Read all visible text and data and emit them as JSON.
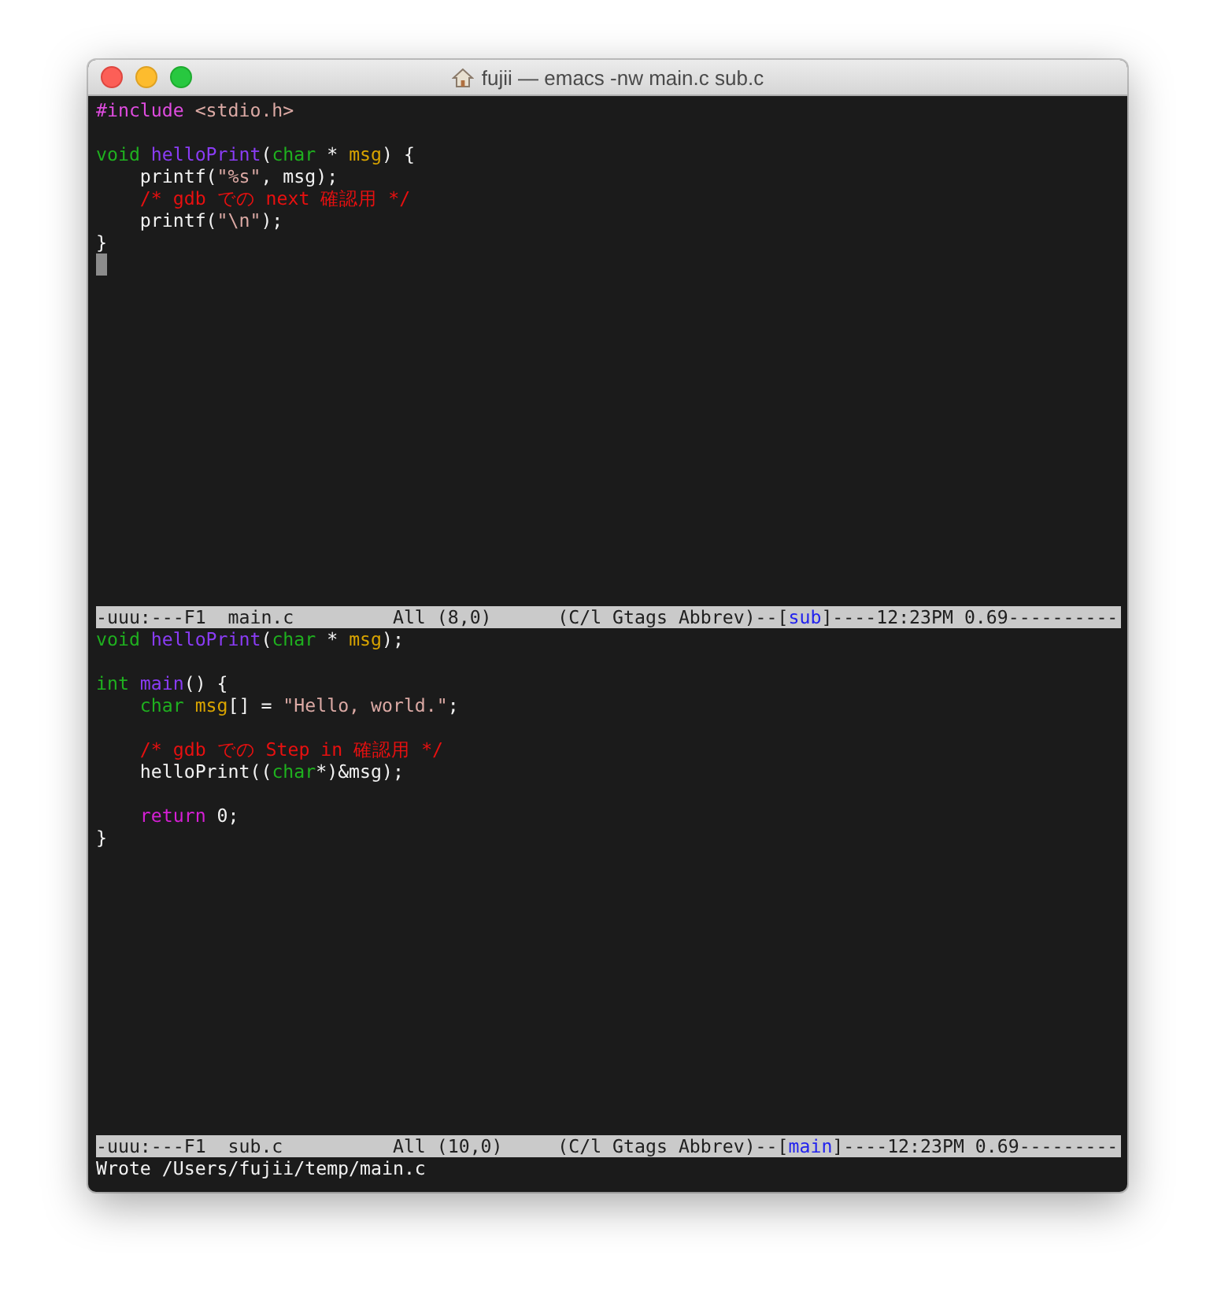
{
  "window": {
    "title": "fujii — emacs -nw main.c sub.c"
  },
  "panes": [
    {
      "lines": [
        {
          "kind": "code",
          "tokens": [
            {
              "text": "#include",
              "kind": "preproc"
            },
            {
              "text": " <stdio.h>",
              "kind": "string"
            }
          ]
        },
        {
          "kind": "blank"
        },
        {
          "kind": "code",
          "tokens": [
            {
              "text": "void",
              "kind": "type"
            },
            {
              "text": " helloPrint",
              "kind": "function"
            },
            {
              "text": "(",
              "kind": "plain"
            },
            {
              "text": "char",
              "kind": "type"
            },
            {
              "text": " * ",
              "kind": "plain"
            },
            {
              "text": "msg",
              "kind": "variable"
            },
            {
              "text": ") {",
              "kind": "plain"
            }
          ]
        },
        {
          "kind": "code",
          "tokens": [
            {
              "text": "    printf(",
              "kind": "plain"
            },
            {
              "text": "\"%s\"",
              "kind": "string"
            },
            {
              "text": ", msg);",
              "kind": "plain"
            }
          ]
        },
        {
          "kind": "code",
          "tokens": [
            {
              "text": "    /* gdb での next 確認用 */",
              "kind": "comment"
            }
          ]
        },
        {
          "kind": "code",
          "tokens": [
            {
              "text": "    printf(",
              "kind": "plain"
            },
            {
              "text": "\"\\n\"",
              "kind": "string"
            },
            {
              "text": ");",
              "kind": "plain"
            }
          ]
        },
        {
          "kind": "code",
          "tokens": [
            {
              "text": "}",
              "kind": "plain"
            }
          ]
        },
        {
          "kind": "cursor"
        }
      ],
      "mode_line": [
        {
          "text": "-uuu:---F1  main.c         All (8,0)      (C/l Gtags Abbrev)--[",
          "kind": "plain"
        },
        {
          "text": "sub",
          "kind": "buffer"
        },
        {
          "text": "]----12:23PM 0.69----------",
          "kind": "plain"
        }
      ]
    },
    {
      "lines": [
        {
          "kind": "code",
          "tokens": [
            {
              "text": "void",
              "kind": "type"
            },
            {
              "text": " helloPrint",
              "kind": "function"
            },
            {
              "text": "(",
              "kind": "plain"
            },
            {
              "text": "char",
              "kind": "type"
            },
            {
              "text": " * ",
              "kind": "plain"
            },
            {
              "text": "msg",
              "kind": "variable"
            },
            {
              "text": ");",
              "kind": "plain"
            }
          ]
        },
        {
          "kind": "blank"
        },
        {
          "kind": "code",
          "tokens": [
            {
              "text": "int",
              "kind": "type"
            },
            {
              "text": " main",
              "kind": "function"
            },
            {
              "text": "() {",
              "kind": "plain"
            }
          ]
        },
        {
          "kind": "code",
          "tokens": [
            {
              "text": "    char",
              "kind": "type"
            },
            {
              "text": " msg",
              "kind": "variable"
            },
            {
              "text": "[] = ",
              "kind": "plain"
            },
            {
              "text": "\"Hello, world.\"",
              "kind": "string"
            },
            {
              "text": ";",
              "kind": "plain"
            }
          ]
        },
        {
          "kind": "blank"
        },
        {
          "kind": "code",
          "tokens": [
            {
              "text": "    /* gdb での Step in 確認用 */",
              "kind": "comment"
            }
          ]
        },
        {
          "kind": "code",
          "tokens": [
            {
              "text": "    helloPrint((",
              "kind": "plain"
            },
            {
              "text": "char",
              "kind": "type"
            },
            {
              "text": "*)&msg);",
              "kind": "plain"
            }
          ]
        },
        {
          "kind": "blank"
        },
        {
          "kind": "code",
          "tokens": [
            {
              "text": "    return",
              "kind": "keyword"
            },
            {
              "text": " 0;",
              "kind": "plain"
            }
          ]
        },
        {
          "kind": "code",
          "tokens": [
            {
              "text": "}",
              "kind": "plain"
            }
          ]
        }
      ],
      "mode_line": [
        {
          "text": "-uuu:---F1  sub.c          All (10,0)     (C/l Gtags Abbrev)--[",
          "kind": "plain"
        },
        {
          "text": "main",
          "kind": "buffer"
        },
        {
          "text": "]----12:23PM 0.69---------",
          "kind": "plain"
        }
      ]
    }
  ],
  "minibuffer": "Wrote /Users/fujii/temp/main.c"
}
